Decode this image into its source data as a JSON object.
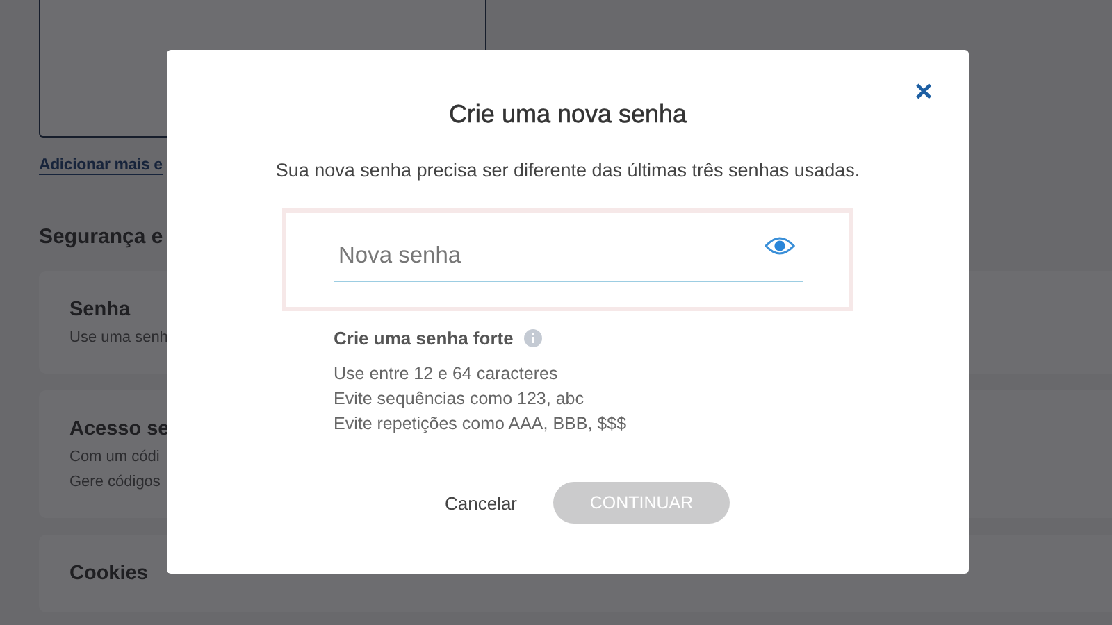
{
  "background": {
    "link": "Adicionar mais e",
    "section_title": "Segurança e",
    "cards": [
      {
        "title": "Senha",
        "lines": [
          "Use uma senh"
        ]
      },
      {
        "title": "Acesso se",
        "lines": [
          "Com um códi",
          "Gere códigos"
        ]
      },
      {
        "title": "Cookies"
      }
    ]
  },
  "dialog": {
    "title": "Crie uma nova senha",
    "close": "×",
    "subtitle": "Sua nova senha precisa ser diferente das últimas três senhas usadas.",
    "field": {
      "placeholder": "Nova senha"
    },
    "hint_title": "Crie uma senha forte",
    "rules": [
      "Use entre 12 e 64 caracteres",
      "Evite sequências como 123, abc",
      "Evite repetições como AAA, BBB, $$$"
    ],
    "cancel": "Cancelar",
    "continue": {
      "label": "CONTINUAR",
      "disabled": true
    }
  }
}
